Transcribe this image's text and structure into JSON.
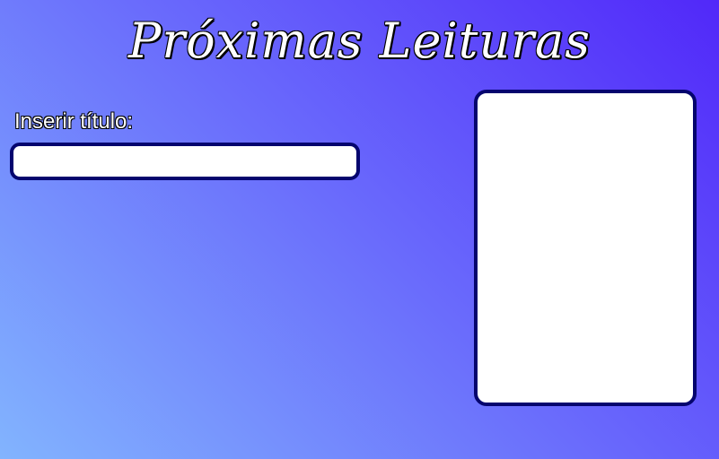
{
  "header": {
    "title": "Próximas Leituras"
  },
  "form": {
    "title_label": "Inserir título:",
    "title_value": "",
    "title_placeholder": ""
  },
  "colors": {
    "gradient_start": "#82b4fe",
    "gradient_end": "#5128f9",
    "border": "#05056e",
    "panel_background": "#ffffff"
  }
}
